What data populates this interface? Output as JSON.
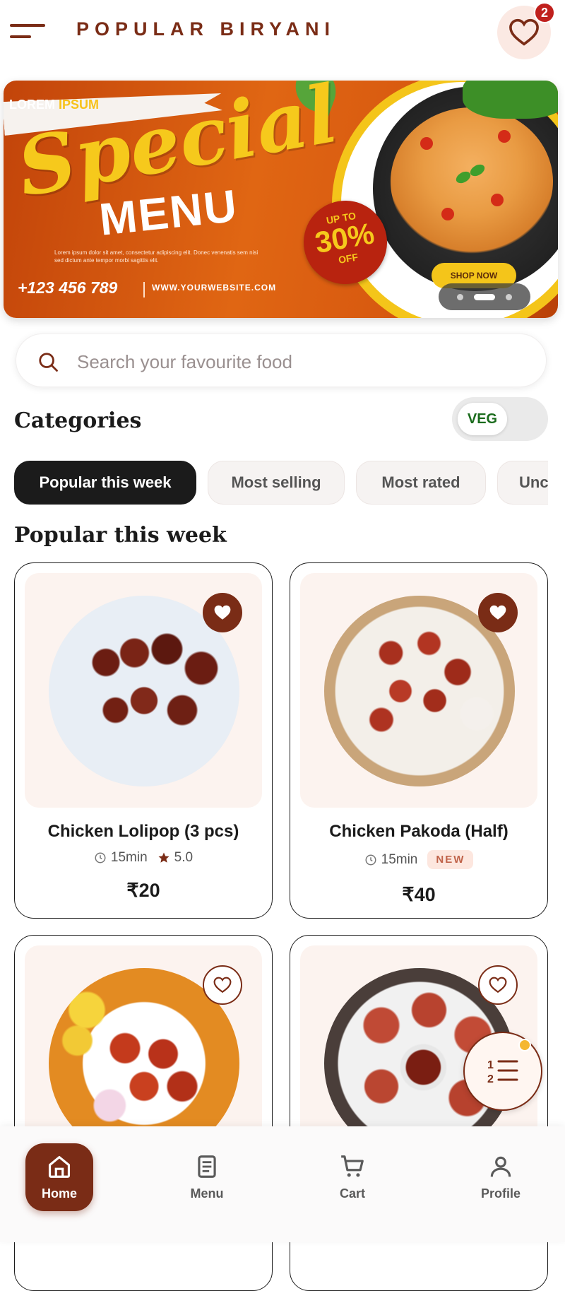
{
  "header": {
    "brand": "POPULAR BIRYANI",
    "favorites_badge": "2"
  },
  "banner": {
    "kicker_a": "LOREM",
    "kicker_b": "IPSUM",
    "title_script": "Special",
    "title_bold": "MENU",
    "description": "Lorem ipsum dolor sit amet, consectetur adipiscing elit. Donec venenatis sem nisi sed dictum ante tempor morbi sagittis elit.",
    "phone": "+123 456 789",
    "website": "WWW.YOURWEBSITE.COM",
    "badge_top": "UP TO",
    "badge_value": "30%",
    "badge_bottom": "OFF",
    "cta": "SHOP NOW",
    "carousel_index": 2,
    "carousel_total": 3
  },
  "search": {
    "placeholder": "Search your favourite food",
    "value": ""
  },
  "categories": {
    "title": "Categories",
    "veg_toggle_label": "VEG",
    "veg_toggle_on": false,
    "chips": [
      "Popular this week",
      "Most selling",
      "Most rated",
      "Unc"
    ]
  },
  "section": {
    "title": "Popular this week"
  },
  "cards": [
    {
      "name": "Chicken Lolipop (3 pcs)",
      "time": "15min",
      "rating": "5.0",
      "badge": "",
      "price": "₹20",
      "favorited": true
    },
    {
      "name": "Chicken Pakoda (Half)",
      "time": "15min",
      "rating": "",
      "badge": "NEW",
      "price": "₹40",
      "favorited": true
    },
    {
      "name": "",
      "time": "",
      "rating": "",
      "badge": "",
      "price": "",
      "favorited": false
    },
    {
      "name": "",
      "time": "",
      "rating": "",
      "badge": "",
      "price": "",
      "favorited": false
    }
  ],
  "nav": {
    "home": "Home",
    "menu": "Menu",
    "cart": "Cart",
    "profile": "Profile"
  },
  "colors": {
    "accent": "#7a2c16",
    "badge_red": "#c0201d",
    "veg_green": "#1a6b1c",
    "chip_active": "#1b1b1b"
  }
}
